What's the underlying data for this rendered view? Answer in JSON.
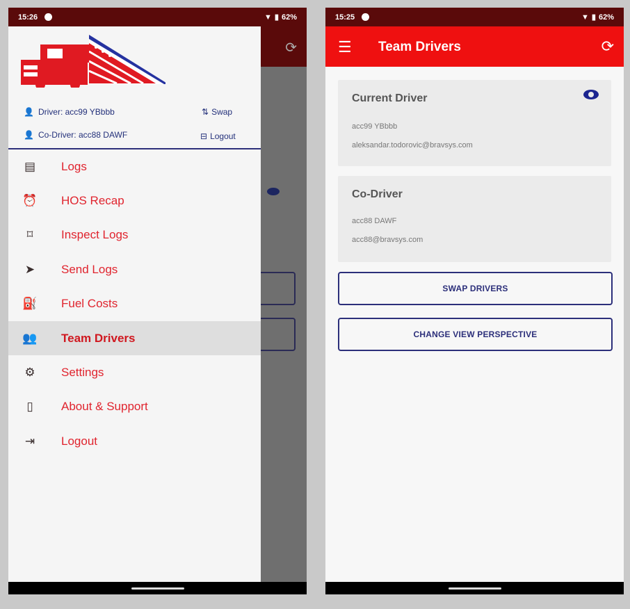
{
  "left_screen": {
    "status_bar": {
      "time": "15:26",
      "battery": "62%"
    },
    "drawer": {
      "driver": "Driver: acc99 YBbbb",
      "co_driver": "Co-Driver: acc88 DAWF",
      "swap_label": "Swap",
      "logout_label": "Logout",
      "items": [
        {
          "label": "Logs",
          "icon": "list-icon"
        },
        {
          "label": "HOS Recap",
          "icon": "alarm-icon"
        },
        {
          "label": "Inspect Logs",
          "icon": "inspect-icon"
        },
        {
          "label": "Send Logs",
          "icon": "send-icon"
        },
        {
          "label": "Fuel Costs",
          "icon": "fuel-icon"
        },
        {
          "label": "Team Drivers",
          "icon": "people-icon",
          "active": true
        },
        {
          "label": "Settings",
          "icon": "gear-icon"
        },
        {
          "label": "About & Support",
          "icon": "phone-icon"
        },
        {
          "label": "Logout",
          "icon": "logout-icon"
        }
      ]
    }
  },
  "right_screen": {
    "status_bar": {
      "time": "15:25",
      "battery": "62%"
    },
    "app_bar": {
      "title": "Team Drivers"
    },
    "current_driver": {
      "title": "Current Driver",
      "name": "acc99 YBbbb",
      "email": "aleksandar.todorovic@bravsys.com"
    },
    "co_driver": {
      "title": "Co-Driver",
      "name": "acc88 DAWF",
      "email": "acc88@bravsys.com"
    },
    "buttons": {
      "swap": "SWAP DRIVERS",
      "perspective": "CHANGE VIEW PERSPECTIVE"
    }
  },
  "colors": {
    "primary": "#ef1010",
    "accent": "#2c2f7a",
    "dark_bar": "#5a0a0a"
  }
}
